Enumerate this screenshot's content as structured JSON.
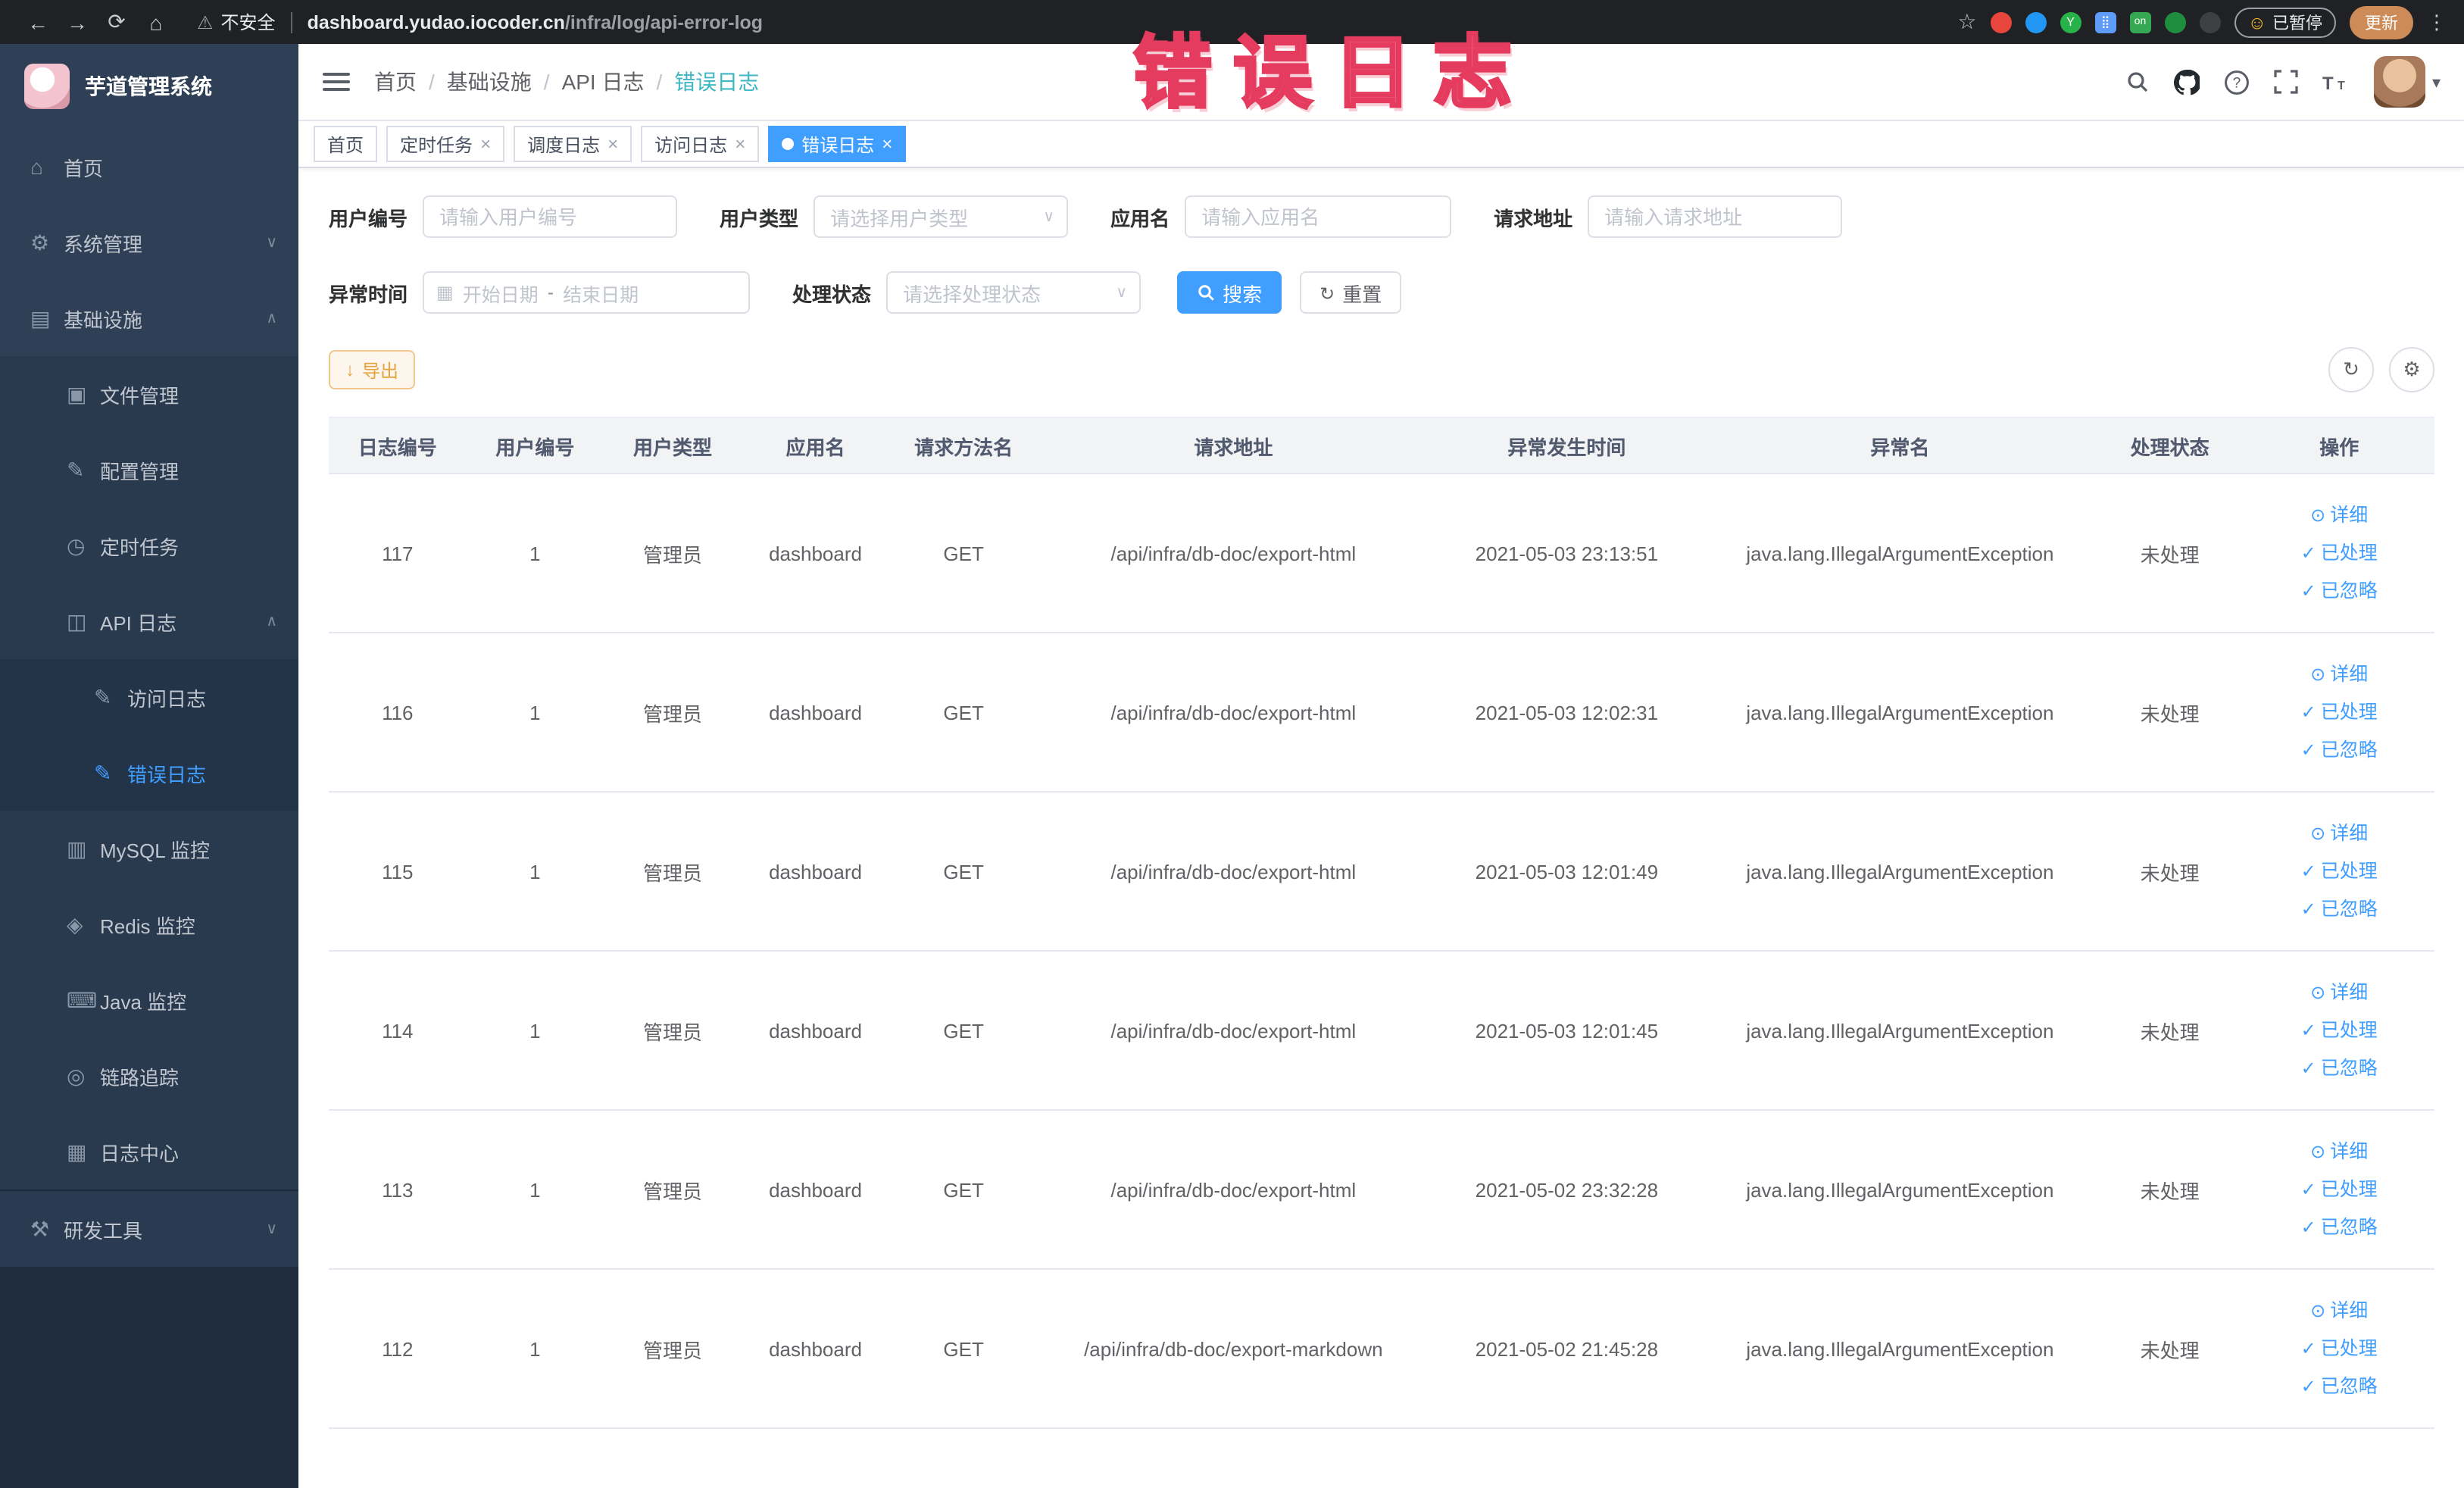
{
  "colors": {
    "accent": "#409eff",
    "warning": "#e6a23c",
    "annotation": "#ec5f7d",
    "sidebar_bg": "#2f4056",
    "chrome_bg": "#202124"
  },
  "browser": {
    "security_label": "不安全",
    "url_host": "dashboard.yudao.iocoder.cn",
    "url_path": "/infra/log/api-error-log",
    "paused_badge": "已暂停",
    "update_button": "更新"
  },
  "sidebar": {
    "logo_title": "芋道管理系统",
    "items": {
      "home": "首页",
      "system": "系统管理",
      "infra": "基础设施",
      "file": "文件管理",
      "config": "配置管理",
      "job": "定时任务",
      "api_log": "API 日志",
      "access_log": "访问日志",
      "error_log": "错误日志",
      "mysql": "MySQL 监控",
      "redis": "Redis 监控",
      "java": "Java 监控",
      "trace": "链路追踪",
      "log_center": "日志中心",
      "dev_tools": "研发工具"
    }
  },
  "header": {
    "breadcrumb": [
      "首页",
      "基础设施",
      "API 日志",
      "错误日志"
    ],
    "sep": "/"
  },
  "annotation_text": "错误日志",
  "tabs": [
    {
      "label": "首页"
    },
    {
      "label": "定时任务"
    },
    {
      "label": "调度日志"
    },
    {
      "label": "访问日志"
    },
    {
      "label": "错误日志"
    }
  ],
  "filters": {
    "user_id": {
      "label": "用户编号",
      "placeholder": "请输入用户编号"
    },
    "user_type": {
      "label": "用户类型",
      "placeholder": "请选择用户类型"
    },
    "app_name": {
      "label": "应用名",
      "placeholder": "请输入应用名"
    },
    "request_url": {
      "label": "请求地址",
      "placeholder": "请输入请求地址"
    },
    "exception_time": {
      "label": "异常时间",
      "start_placeholder": "开始日期",
      "separator": "-",
      "end_placeholder": "结束日期"
    },
    "process_status": {
      "label": "处理状态",
      "placeholder": "请选择处理状态"
    },
    "search_button": "搜索",
    "reset_button": "重置"
  },
  "toolbar": {
    "export_button": "导出"
  },
  "table": {
    "columns": [
      "日志编号",
      "用户编号",
      "用户类型",
      "应用名",
      "请求方法名",
      "请求地址",
      "异常发生时间",
      "异常名",
      "处理状态",
      "操作"
    ],
    "actions": {
      "detail": "详细",
      "done": "已处理",
      "ignore": "已忽略"
    },
    "rows": [
      {
        "id": "117",
        "user_id": "1",
        "user_type": "管理员",
        "app": "dashboard",
        "method": "GET",
        "url": "/api/infra/db-doc/export-html",
        "time": "2021-05-03 23:13:51",
        "exception": "java.lang.IllegalArgumentException",
        "status": "未处理"
      },
      {
        "id": "116",
        "user_id": "1",
        "user_type": "管理员",
        "app": "dashboard",
        "method": "GET",
        "url": "/api/infra/db-doc/export-html",
        "time": "2021-05-03 12:02:31",
        "exception": "java.lang.IllegalArgumentException",
        "status": "未处理"
      },
      {
        "id": "115",
        "user_id": "1",
        "user_type": "管理员",
        "app": "dashboard",
        "method": "GET",
        "url": "/api/infra/db-doc/export-html",
        "time": "2021-05-03 12:01:49",
        "exception": "java.lang.IllegalArgumentException",
        "status": "未处理"
      },
      {
        "id": "114",
        "user_id": "1",
        "user_type": "管理员",
        "app": "dashboard",
        "method": "GET",
        "url": "/api/infra/db-doc/export-html",
        "time": "2021-05-03 12:01:45",
        "exception": "java.lang.IllegalArgumentException",
        "status": "未处理"
      },
      {
        "id": "113",
        "user_id": "1",
        "user_type": "管理员",
        "app": "dashboard",
        "method": "GET",
        "url": "/api/infra/db-doc/export-html",
        "time": "2021-05-02 23:32:28",
        "exception": "java.lang.IllegalArgumentException",
        "status": "未处理"
      },
      {
        "id": "112",
        "user_id": "1",
        "user_type": "管理员",
        "app": "dashboard",
        "method": "GET",
        "url": "/api/infra/db-doc/export-markdown",
        "time": "2021-05-02 21:45:28",
        "exception": "java.lang.IllegalArgumentException",
        "status": "未处理"
      }
    ]
  }
}
